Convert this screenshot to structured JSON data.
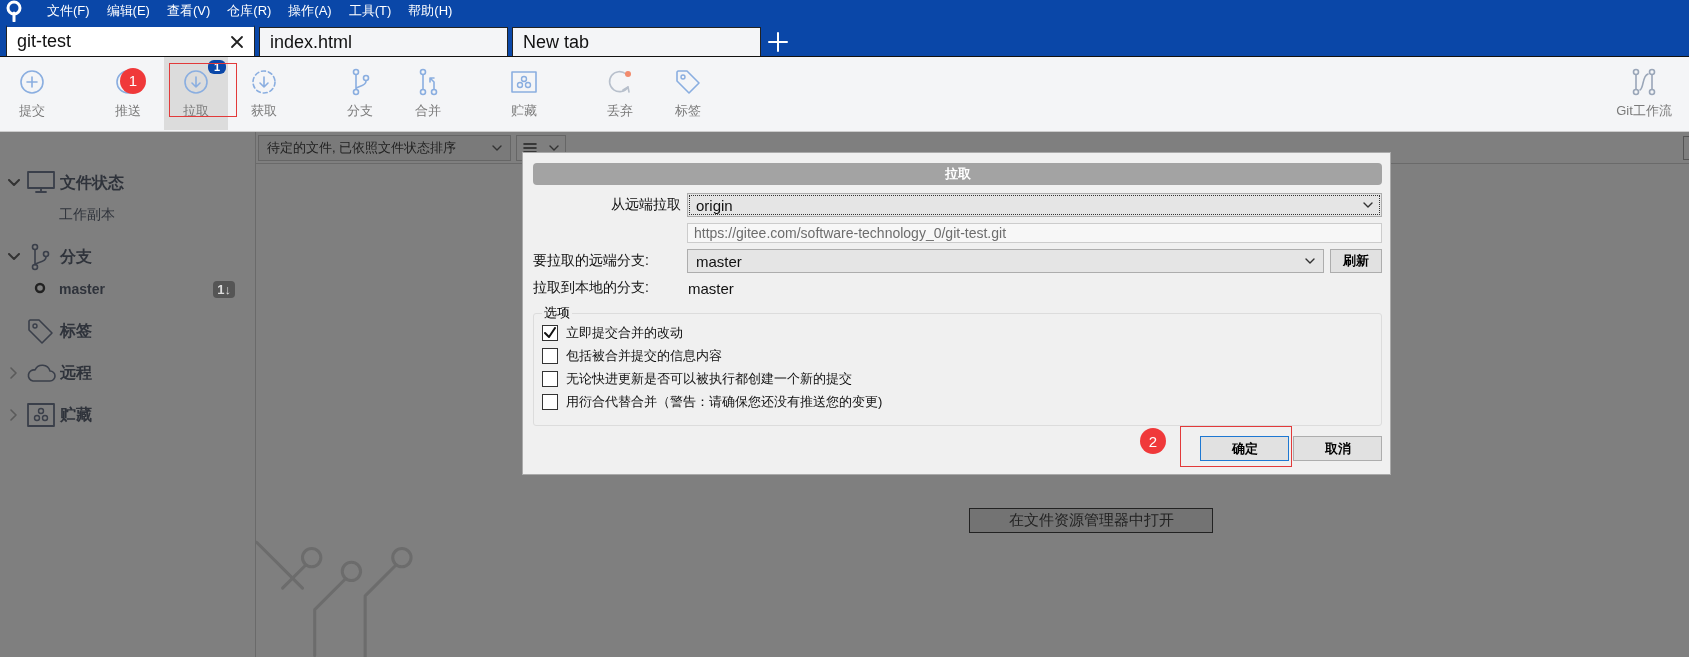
{
  "menu_bar": {
    "items": [
      "文件(F)",
      "编辑(E)",
      "查看(V)",
      "仓库(R)",
      "操作(A)",
      "工具(T)",
      "帮助(H)"
    ]
  },
  "tabs": [
    {
      "label": "git-test",
      "selected": true,
      "closable": true
    },
    {
      "label": "index.html",
      "selected": false,
      "closable": false
    },
    {
      "label": "New tab",
      "selected": false,
      "closable": false
    }
  ],
  "toolbar": {
    "groups": [
      [
        {
          "kind": "commit",
          "label": "提交",
          "selected": false
        }
      ],
      [
        {
          "kind": "push",
          "label": "推送",
          "selected": false,
          "marker": "1"
        },
        {
          "kind": "pull",
          "label": "拉取",
          "selected": true,
          "badge": "1",
          "highlighted": true
        },
        {
          "kind": "fetch",
          "label": "获取",
          "selected": false
        }
      ],
      [
        {
          "kind": "branch",
          "label": "分支",
          "selected": false
        },
        {
          "kind": "merge",
          "label": "合并",
          "selected": false
        }
      ],
      [
        {
          "kind": "stash",
          "label": "贮藏",
          "selected": false
        }
      ],
      [
        {
          "kind": "discard",
          "label": "丢弃",
          "selected": false
        },
        {
          "kind": "tag",
          "label": "标签",
          "selected": false
        }
      ]
    ],
    "right": {
      "kind": "flow",
      "label": "Git工作流"
    }
  },
  "sidebar": {
    "sections": [
      {
        "kind": "status",
        "title": "文件状态",
        "expanded": true,
        "children": [
          {
            "label": "工作副本",
            "current": false
          }
        ]
      },
      {
        "kind": "branch",
        "title": "分支",
        "expanded": true,
        "children": [
          {
            "label": "master",
            "current": true,
            "badge": "1↓"
          }
        ]
      },
      {
        "kind": "tag",
        "title": "标签"
      },
      {
        "kind": "remote",
        "title": "远程",
        "expanded": false
      },
      {
        "kind": "stash",
        "title": "贮藏",
        "expanded": false
      }
    ]
  },
  "filter_bar": {
    "sort": "待定的文件, 已依照文件状态排序"
  },
  "open_button": "在文件资源管理器中打开",
  "dialog": {
    "title": "拉取",
    "remote_label": "从远端拉取",
    "remote": "origin",
    "url": "https://gitee.com/software-technology_0/git-test.git",
    "branch_label": "要拉取的远端分支:",
    "branch": "master",
    "refresh": "刷新",
    "local_label": "拉取到本地的分支:",
    "local": "master",
    "options_title": "选项",
    "options": [
      {
        "label": "立即提交合并的改动",
        "checked": true
      },
      {
        "label": "包括被合并提交的信息内容",
        "checked": false
      },
      {
        "label": "无论快进更新是否可以被执行都创建一个新的提交",
        "checked": false
      },
      {
        "label": "用衍合代替合并（警告：请确保您还没有推送您的变更)",
        "checked": false
      }
    ],
    "buttons": [
      {
        "label": "确定",
        "default": true,
        "highlighted": true,
        "marker": "2"
      },
      {
        "label": "取消",
        "default": false
      }
    ]
  }
}
